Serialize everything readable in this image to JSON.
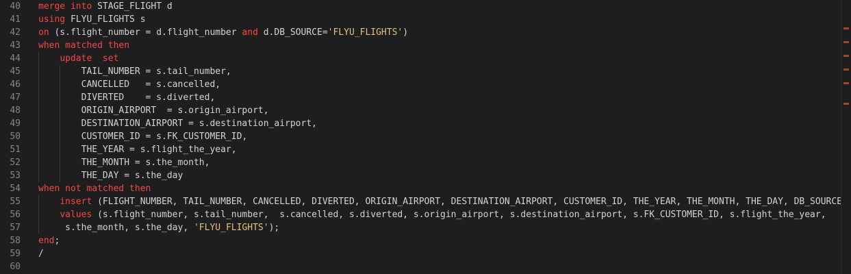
{
  "line_numbers": [
    "40",
    "41",
    "42",
    "43",
    "44",
    "45",
    "46",
    "47",
    "48",
    "49",
    "50",
    "51",
    "52",
    "53",
    "54",
    "55",
    "56",
    "57",
    "58",
    "59",
    "60"
  ],
  "code": {
    "l40": {
      "kw1": "merge into",
      "t1": " STAGE_FLIGHT d"
    },
    "l41": {
      "kw1": "using",
      "t1": " FLYU_FLIGHTS s"
    },
    "l42": {
      "kw1": "on",
      "t1": " (s.flight_number = d.flight_number ",
      "kw2": "and",
      "t2": " d.DB_SOURCE=",
      "s1": "'FLYU_FLIGHTS'",
      "t3": ")"
    },
    "l43": {
      "kw1": "when matched then"
    },
    "l44": {
      "ind": "    ",
      "kw1": "update  set"
    },
    "l45": {
      "t1": "        TAIL_NUMBER = s.tail_number,"
    },
    "l46": {
      "t1": "        CANCELLED   = s.cancelled,"
    },
    "l47": {
      "t1": "        DIVERTED    = s.diverted,"
    },
    "l48": {
      "t1": "        ORIGIN_AIRPORT  = s.origin_airport,"
    },
    "l49": {
      "t1": "        DESTINATION_AIRPORT = s.destination_airport,"
    },
    "l50": {
      "t1": "        CUSTOMER_ID = s.FK_CUSTOMER_ID,"
    },
    "l51": {
      "t1": "        THE_YEAR = s.flight_the_year,"
    },
    "l52": {
      "t1": "        THE_MONTH = s.the_month,"
    },
    "l53": {
      "t1": "        THE_DAY = s.the_day"
    },
    "l54": {
      "kw1": "when not matched then"
    },
    "l55": {
      "ind": "    ",
      "kw1": "insert",
      "t1": " (FLIGHT_NUMBER, TAIL_NUMBER, CANCELLED, DIVERTED, ORIGIN_AIRPORT, DESTINATION_AIRPORT, CUSTOMER_ID, THE_YEAR, THE_MONTH, THE_DAY, DB_SOURCE)"
    },
    "l56": {
      "ind": "    ",
      "kw1": "values",
      "t1": " (s.flight_number, s.tail_number,  s.cancelled, s.diverted, s.origin_airport, s.destination_airport, s.FK_CUSTOMER_ID, s.flight_the_year,"
    },
    "l57": {
      "t1": "     s.the_month, s.the_day, ",
      "s1": "'FLYU_FLIGHTS'",
      "t2": ");"
    },
    "l58": {
      "kw1": "end",
      "t1": ";"
    },
    "l59": {
      "t1": "/"
    },
    "l60": {
      "t1": ""
    }
  },
  "colors": {
    "background": "#1e1e1e",
    "keyword": "#f44747",
    "string": "#e5c07b",
    "text": "#d4d4d4",
    "line_number": "#858585"
  }
}
